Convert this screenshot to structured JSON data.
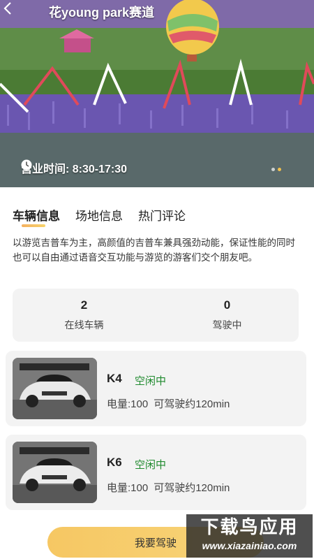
{
  "header": {
    "title": "花young park赛道"
  },
  "hero": {
    "hours_text": "营业时间: 8:30-17:30",
    "carousel_total": 2,
    "carousel_active": 1
  },
  "tabs": [
    {
      "label": "车辆信息",
      "active": true
    },
    {
      "label": "场地信息",
      "active": false
    },
    {
      "label": "热门评论",
      "active": false
    }
  ],
  "description": "以游览吉普车为主，高颜值的吉普车兼具强劲动能，保证性能的同时也可以自由通过语音交互功能与游览的游客们交个朋友吧。",
  "stats": [
    {
      "value": "2",
      "label": "在线车辆"
    },
    {
      "value": "0",
      "label": "驾驶中"
    }
  ],
  "vehicles": [
    {
      "name": "K4",
      "status": "空闲中",
      "battery": "电量:100",
      "range": "可驾驶约120min"
    },
    {
      "name": "K6",
      "status": "空闲中",
      "battery": "电量:100",
      "range": "可驾驶约120min"
    }
  ],
  "action": {
    "drive_label": "我要驾驶"
  },
  "watermark": {
    "main": "下载鸟应用",
    "url": "www.xiazainiao.com"
  },
  "colors": {
    "accent": "#f6c763",
    "status_green": "#1f8a2e"
  }
}
